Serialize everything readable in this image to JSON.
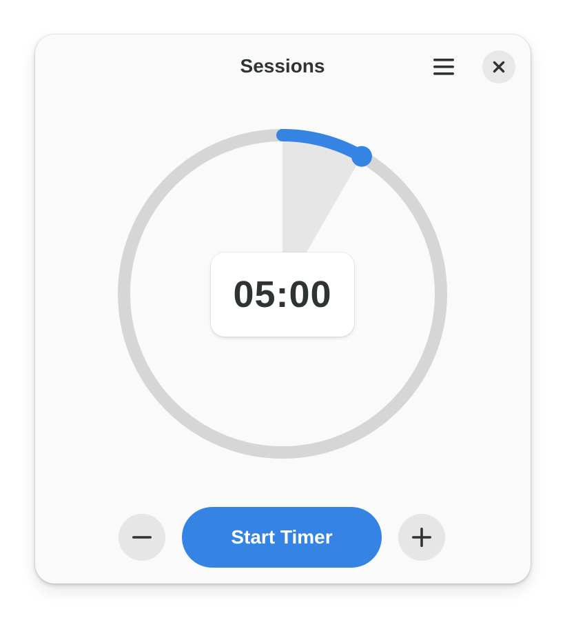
{
  "header": {
    "title": "Sessions",
    "menu_icon": "hamburger-menu-icon",
    "close_icon": "close-icon"
  },
  "timer": {
    "display": "05:00",
    "progress_fraction": 0.0833
  },
  "controls": {
    "start_label": "Start Timer",
    "decrement_icon": "minus-icon",
    "increment_icon": "plus-icon"
  },
  "colors": {
    "accent": "#3584e4",
    "track": "#d6d6d6",
    "wedge": "#e6e6e6",
    "text": "#2e3436"
  }
}
